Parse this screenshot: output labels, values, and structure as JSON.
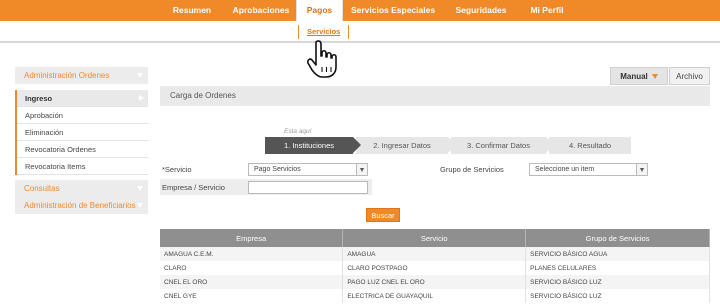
{
  "topnav": {
    "items": [
      "Resumen",
      "Aprobaciones",
      "Pagos",
      "Servicios Especiales",
      "Seguridades",
      "Mi Perfil"
    ],
    "active": "Pagos"
  },
  "subnav": {
    "link": "Servicios"
  },
  "sidebar": {
    "section1": "Administración Ordenes",
    "items": [
      "Ingreso",
      "Aprobación",
      "Eliminación",
      "Revocatoria Ordenes",
      "Revocatoria Items"
    ],
    "section2": "Consultas",
    "section3": "Administración de Beneficiarios"
  },
  "tabs": {
    "manual": "Manual",
    "archivo": "Archivo"
  },
  "main": {
    "title": "Carga de Ordenes"
  },
  "wizard": {
    "note": "Esta aquí",
    "steps": [
      "1. Instituciones",
      "2. Ingresar Datos",
      "3. Confirmar Datos",
      "4. Resultado"
    ]
  },
  "form": {
    "servicio_label": "*Servicio",
    "servicio_value": "Pago Servicios",
    "empresa_label": "Empresa / Servicio",
    "empresa_value": "",
    "grupo_label": "Grupo de Servicios",
    "grupo_value": "Seleccione un item",
    "search_button": "Buscar"
  },
  "table": {
    "headers": [
      "Empresa",
      "Servicio",
      "Grupo de Servicios"
    ],
    "rows": [
      [
        "AMAGUA C.E.M.",
        "AMAGUA",
        "SERVICIO BÁSICO AGUA"
      ],
      [
        "CLARO",
        "CLARO POSTPAGO",
        "PLANES CELULARES"
      ],
      [
        "CNEL EL ORO",
        "PAGO LUZ CNEL EL ORO",
        "SERVICIO BÁSICO LUZ"
      ],
      [
        "CNEL GYE",
        "ELECTRICA DE GUAYAQUIL",
        "SERVICIO BÁSICO LUZ"
      ]
    ]
  },
  "colors": {
    "accent": "#f08a28",
    "header_gray": "#8f8f8f",
    "step_active": "#555555"
  }
}
